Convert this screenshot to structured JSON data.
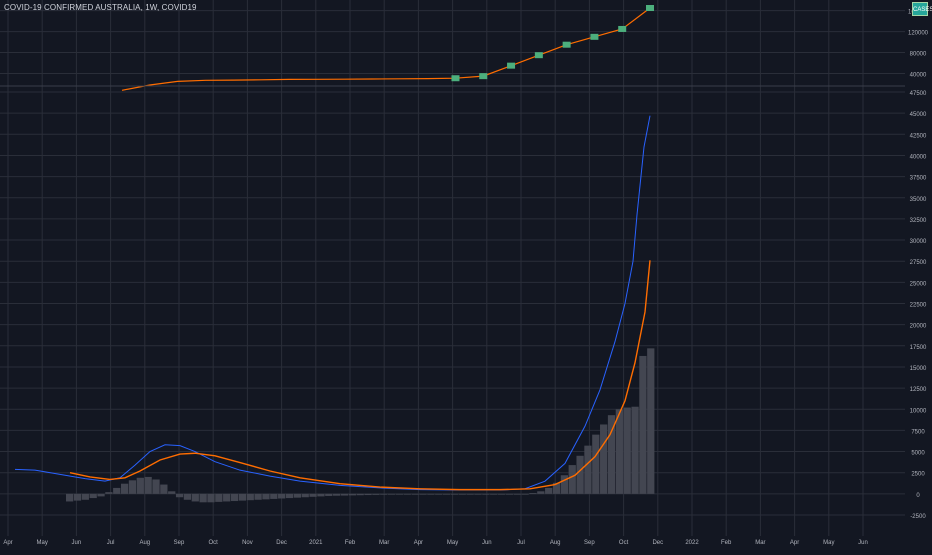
{
  "window": {
    "title": "COVID-19 CONFIRMED AUSTRALIA, 1W, COVID19",
    "badge": "CASES"
  },
  "colors": {
    "background": "#131722",
    "grid": "#2a2e39",
    "price_line": "#f7931a",
    "up_bar": "#4caf7d",
    "orange_line": "#ff6d00",
    "blue_line": "#2962ff",
    "histogram": "#434651",
    "axis_text": "#b2b5be"
  },
  "chart_data": [
    {
      "type": "line",
      "name": "price-pane",
      "ylim": [
        20000,
        165000
      ],
      "y_ticks": [
        "40000",
        "80000",
        "120000",
        "160000"
      ],
      "x": [
        "Jul",
        "Aug",
        "Sep",
        "Oct",
        "Nov",
        "Dec",
        "2021",
        "Feb",
        "Mar",
        "Apr",
        "May",
        "Jun",
        "Jul",
        "Aug",
        "Aug2",
        "Sep",
        "Sep2",
        "Oct",
        "Oct2",
        "Nov"
      ],
      "values": [
        8000,
        18000,
        25000,
        27000,
        27500,
        28000,
        28800,
        29000,
        29200,
        29500,
        30000,
        30300,
        31000,
        35000,
        55000,
        75000,
        95000,
        110000,
        125000,
        165000
      ]
    },
    {
      "type": "line",
      "name": "indicator-pane",
      "ylim": [
        -2500,
        47500
      ],
      "y_ticks": [
        "47500",
        "45000",
        "42500",
        "40000",
        "37500",
        "35000",
        "32500",
        "30000",
        "27500",
        "25000",
        "22500",
        "20000",
        "17500",
        "15000",
        "12500",
        "10000",
        "7500",
        "5000",
        "2500",
        "0",
        "-2500"
      ],
      "x_ticks": [
        "Apr",
        "May",
        "Jun",
        "Jul",
        "Aug",
        "Sep",
        "Oct",
        "Nov",
        "Dec",
        "2021",
        "Feb",
        "Mar",
        "Apr",
        "May",
        "Jun",
        "Jul",
        "Aug",
        "Sep",
        "Oct",
        "Dec",
        "2022",
        "Feb",
        "Mar",
        "Apr",
        "May",
        "Jun"
      ],
      "histogram": [
        -900,
        -800,
        -700,
        -500,
        -300,
        200,
        700,
        1200,
        1600,
        1900,
        2000,
        1700,
        1100,
        300,
        -400,
        -700,
        -900,
        -1000,
        -1000,
        -950,
        -900,
        -850,
        -800,
        -750,
        -700,
        -650,
        -600,
        -550,
        -500,
        -450,
        -400,
        -350,
        -300,
        -250,
        -220,
        -200,
        -180,
        -160,
        -140,
        -120,
        -100,
        -80,
        -60,
        -40,
        -20,
        0,
        0,
        0,
        0,
        0,
        0,
        0,
        0,
        0,
        0,
        0,
        0,
        0,
        0,
        100,
        300,
        700,
        1300,
        2200,
        3400,
        4500,
        5700,
        7000,
        8200,
        9300,
        10000,
        10200,
        10300,
        16300,
        17200
      ]
    }
  ]
}
